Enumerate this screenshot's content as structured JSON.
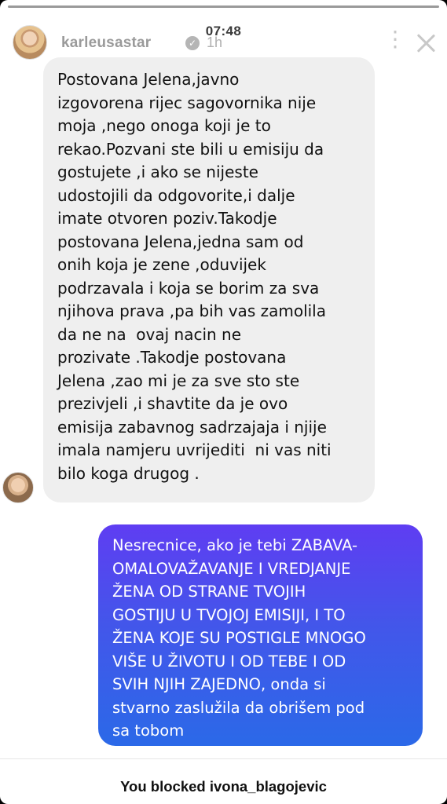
{
  "status_bar": {
    "clock": "07:48"
  },
  "story": {
    "progress": 1.0,
    "username": "karleusastar",
    "verified_icon": "verified-badge-icon",
    "verified_glyph": "✓",
    "time_ago": "1h",
    "more_icon": "more-vertical-icon",
    "more_glyph": "⋮",
    "close_icon": "close-icon"
  },
  "messages": [
    {
      "direction": "received",
      "text": "Postovana Jelena,javno\nizgovorena rijec sagovornika nije\nmoja ,nego onoga koji je to\nrekao.Pozvani ste bili u emisiju da\ngostujete ,i ako se nijeste\nudostojili da odgovorite,i dalje\nimate otvoren poziv.Takodje\npostovana Jelena,jedna sam od\nonih koja je zene ,oduvijek\npodrzavala i koja se borim za sva\nnjihova prava ,pa bih vas zamolila\nda ne na  ovaj nacin ne\nprozivate .Takodje postovana\nJelena ,zao mi je za sve sto ste\nprezivjeli ,i shavtite da je ovo\nemisija zabavnog sadrzajaja i njije\nimala namjeru uvrijediti  ni vas niti\nbilo koga drugog ."
    },
    {
      "direction": "sent",
      "text": "Nesrecnice, ako je tebi ZABAVA-\nOMALOVAŽAVANJE I VREDJANJE\nŽENA OD STRANE TVOJIH\nGOSTIJU U TVOJOJ EMISIJI, I TO\nŽENA KOJE SU POSTIGLE MNOGO\nVIŠE U ŽIVOTU I OD TEBE I OD\nSVIH NJIH ZAJEDNO, onda si\nstvarno zaslužila da obrišem pod\nsa tobom"
    }
  ],
  "footer": {
    "blocked_notice": "You blocked ivona_blagojevic"
  },
  "colors": {
    "received_bubble": "#efefef",
    "sent_bubble_top": "#5f3df2",
    "sent_bubble_bottom": "#2b69e8"
  }
}
